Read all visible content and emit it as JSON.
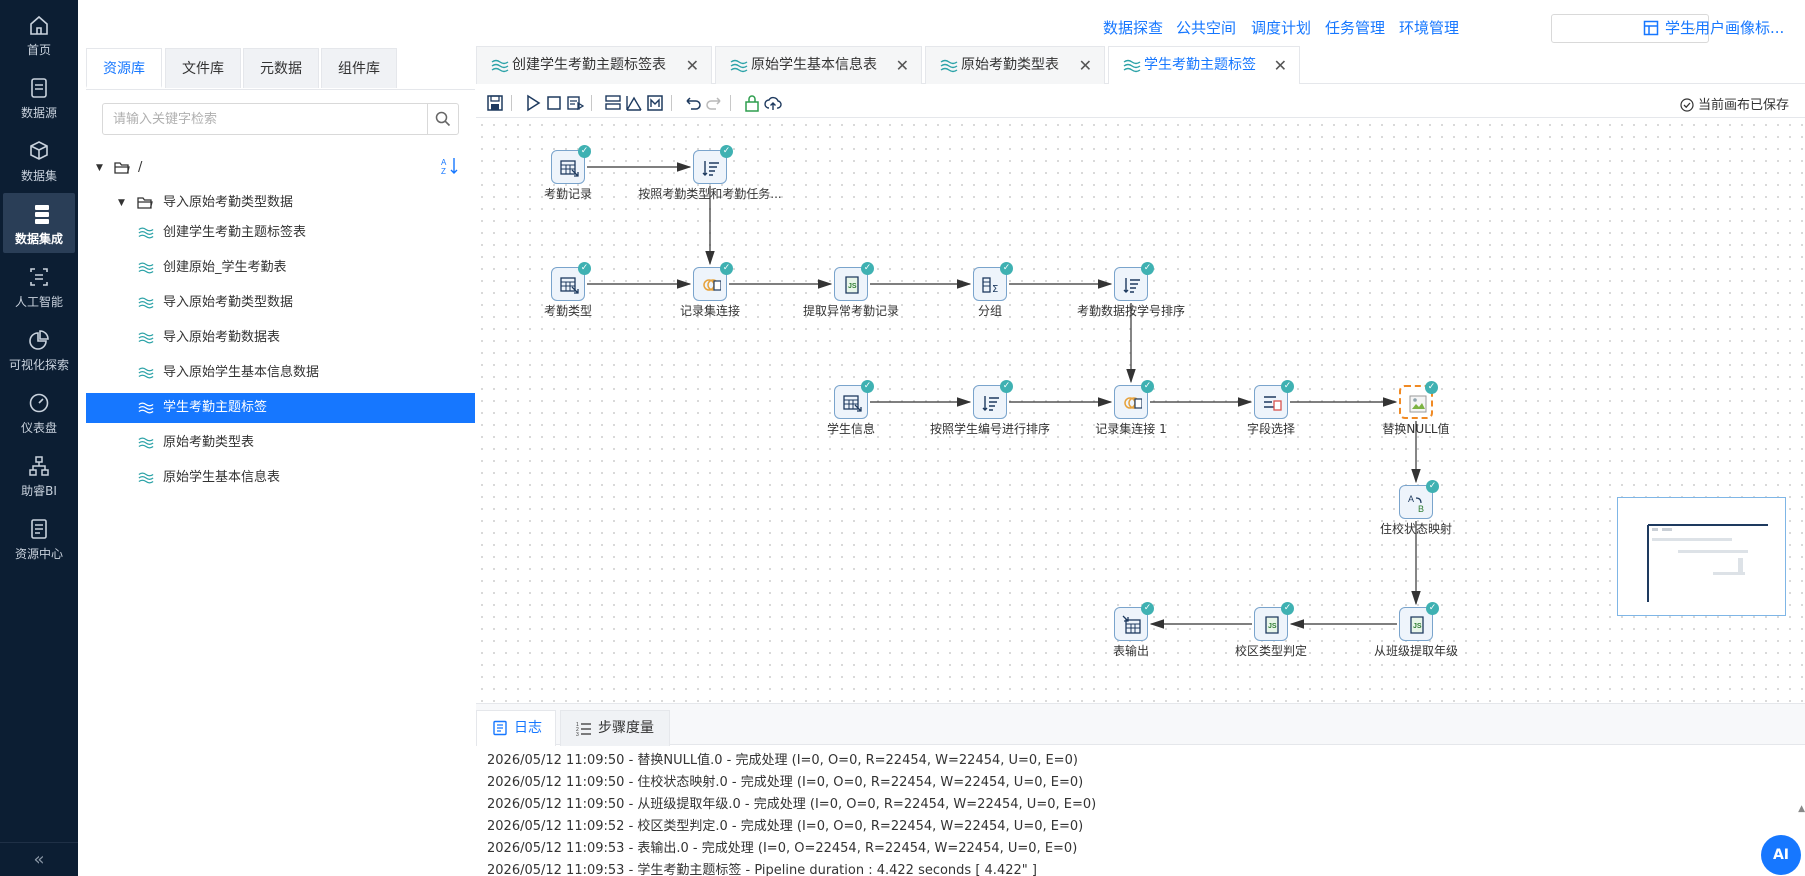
{
  "colors": {
    "nav_bg": "#0c1e33",
    "accent": "#1677ff",
    "node_badge": "#3fb1b2",
    "selected_node_border": "#f08a24"
  },
  "left_nav": {
    "items": [
      {
        "label": "首页",
        "icon": "home-icon"
      },
      {
        "label": "数据源",
        "icon": "database-icon"
      },
      {
        "label": "数据集",
        "icon": "cube-icon"
      },
      {
        "label": "数据集成",
        "icon": "server-stack-icon",
        "active": true
      },
      {
        "label": "人工智能",
        "icon": "ai-scan-icon"
      },
      {
        "label": "可视化探索",
        "icon": "pie-chart-icon"
      },
      {
        "label": "仪表盘",
        "icon": "gauge-icon"
      },
      {
        "label": "助睿BI",
        "icon": "org-chart-icon"
      },
      {
        "label": "资源中心",
        "icon": "document-icon"
      }
    ],
    "collapse": "«"
  },
  "top_nav": {
    "links": [
      "数据探查",
      "公共空间",
      "调度计划",
      "任务管理",
      "环境管理"
    ],
    "select_value": "",
    "title": "学生用户画像标..."
  },
  "resource_panel": {
    "tabs": [
      "资源库",
      "文件库",
      "元数据",
      "组件库"
    ],
    "search_placeholder": "请输入关键字检索",
    "tree": {
      "root": "/",
      "folder": "导入原始考勤类型数据",
      "items": [
        "创建学生考勤主题标签表",
        "创建原始_学生考勤表",
        "导入原始考勤类型数据",
        "导入原始考勤数据表",
        "导入原始学生基本信息数据",
        "学生考勤主题标签",
        "原始考勤类型表",
        "原始学生基本信息表"
      ],
      "selected_index": 5
    }
  },
  "editor_tabs": [
    {
      "label": "创建学生考勤主题标签表",
      "active": false
    },
    {
      "label": "原始学生基本信息表",
      "active": false
    },
    {
      "label": "原始考勤类型表",
      "active": false
    },
    {
      "label": "学生考勤主题标签",
      "active": true
    }
  ],
  "toolbar": {
    "saved_status": "当前画布已保存"
  },
  "pipeline": {
    "nodes": [
      {
        "id": "n1",
        "label": "考勤记录",
        "icon": "table-input-icon"
      },
      {
        "id": "n2",
        "label": "按照考勤类型和考勤任务...",
        "icon": "sort-icon"
      },
      {
        "id": "n3",
        "label": "考勤类型",
        "icon": "table-input-icon"
      },
      {
        "id": "n4",
        "label": "记录集连接",
        "icon": "join-icon"
      },
      {
        "id": "n5",
        "label": "提取异常考勤记录",
        "icon": "js-script-icon"
      },
      {
        "id": "n6",
        "label": "分组",
        "icon": "group-by-icon"
      },
      {
        "id": "n7",
        "label": "考勤数据按学号排序",
        "icon": "sort-icon"
      },
      {
        "id": "n8",
        "label": "学生信息",
        "icon": "table-input-icon"
      },
      {
        "id": "n9",
        "label": "按照学生编号进行排序",
        "icon": "sort-icon"
      },
      {
        "id": "n10",
        "label": "记录集连接 1",
        "icon": "join-icon"
      },
      {
        "id": "n11",
        "label": "字段选择",
        "icon": "field-select-icon"
      },
      {
        "id": "n12",
        "label": "替换NULL值",
        "icon": "broken-image-icon",
        "selected": true
      },
      {
        "id": "n13",
        "label": "住校状态映射",
        "icon": "value-mapper-icon"
      },
      {
        "id": "n14",
        "label": "从班级提取年级",
        "icon": "js-script-icon"
      },
      {
        "id": "n15",
        "label": "校区类型判定",
        "icon": "js-script-icon"
      },
      {
        "id": "n16",
        "label": "表输出",
        "icon": "table-output-icon"
      }
    ],
    "edges": [
      [
        "n1",
        "n2"
      ],
      [
        "n2",
        "n4"
      ],
      [
        "n3",
        "n4"
      ],
      [
        "n4",
        "n5"
      ],
      [
        "n5",
        "n6"
      ],
      [
        "n6",
        "n7"
      ],
      [
        "n7",
        "n10"
      ],
      [
        "n8",
        "n9"
      ],
      [
        "n9",
        "n10"
      ],
      [
        "n10",
        "n11"
      ],
      [
        "n11",
        "n12"
      ],
      [
        "n12",
        "n13"
      ],
      [
        "n13",
        "n14"
      ],
      [
        "n14",
        "n15"
      ],
      [
        "n15",
        "n16"
      ]
    ]
  },
  "bottom_panel": {
    "tabs": [
      "日志",
      "步骤度量"
    ],
    "log_lines": [
      "2026/05/12 11:09:50 - 替换NULL值.0 - 完成处理 (I=0, O=0, R=22454, W=22454, U=0, E=0)",
      "2026/05/12 11:09:50 - 住校状态映射.0 - 完成处理 (I=0, O=0, R=22454, W=22454, U=0, E=0)",
      "2026/05/12 11:09:50 - 从班级提取年级.0 - 完成处理 (I=0, O=0, R=22454, W=22454, U=0, E=0)",
      "2026/05/12 11:09:52 - 校区类型判定.0 - 完成处理 (I=0, O=0, R=22454, W=22454, U=0, E=0)",
      "2026/05/12 11:09:53 - 表输出.0 - 完成处理 (I=0, O=22454, R=22454, W=22454, U=0, E=0)",
      "2026/05/12 11:09:53 - 学生考勤主题标签 - Pipeline duration : 4.422 seconds [  4.422\" ]"
    ]
  },
  "ai_button": "AI"
}
